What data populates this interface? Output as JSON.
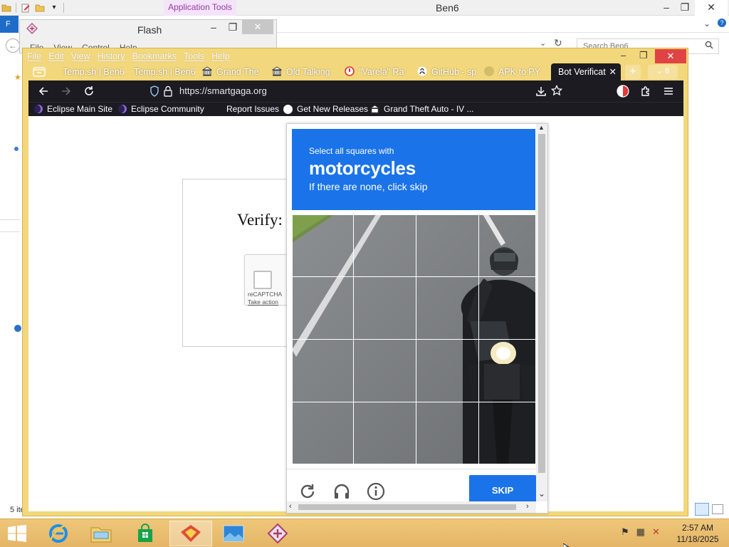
{
  "explorer": {
    "title": "Ben6",
    "app_tools_tab": "Application Tools",
    "file_tab": "F",
    "search_placeholder": "Search Ben6",
    "status_text": "5 ite",
    "controls": {
      "minimize": "–",
      "maximize": "❐",
      "close": "✕"
    }
  },
  "flash": {
    "title": "Flash",
    "menu": [
      "File",
      "View",
      "Control",
      "Help"
    ],
    "controls": {
      "minimize": "–",
      "maximize": "❐",
      "close": "✕"
    }
  },
  "firefox": {
    "menu": [
      "File",
      "Edit",
      "View",
      "History",
      "Bookmarks",
      "Tools",
      "Help"
    ],
    "controls": {
      "minimize": "–",
      "maximize": "❐",
      "close": "✕"
    },
    "tabs": [
      {
        "label": "Temp.sh | Ben6",
        "icon": "bookmark-icon"
      },
      {
        "label": "Temp.sh | Ben6",
        "icon": "bookmark-icon"
      },
      {
        "label": "Grand The",
        "icon": "museum-icon"
      },
      {
        "label": "Old Talking",
        "icon": "museum-icon"
      },
      {
        "label": "\"Varela\" Ra",
        "icon": "record-icon"
      },
      {
        "label": "GitHub - sp",
        "icon": "github-icon"
      },
      {
        "label": "APK to PY",
        "icon": "generic-icon"
      }
    ],
    "active_tab": {
      "label": "Bot Verificat",
      "close": "✕"
    },
    "new_tab": "+",
    "tab_count": "8",
    "url": "https://smartgaga.org",
    "bookmarks": [
      "Eclipse Main Site",
      "Eclipse Community",
      "Report Issues",
      "Get New Releases",
      "Grand Theft Auto - IV ..."
    ]
  },
  "page": {
    "verify_title": "Verify:",
    "recaptcha_label": "reCAPTCHA",
    "recaptcha_action": "Take action"
  },
  "challenge": {
    "instruction_small": "Select all squares with",
    "target": "motorcycles",
    "instruction_sub": "If there are none, click skip",
    "grid_rows": 4,
    "grid_cols": 4,
    "skip_label": "SKIP",
    "footer_icons": [
      "reload-icon",
      "audio-icon",
      "info-icon"
    ]
  },
  "taskbar": {
    "apps": [
      "ie-icon",
      "file-explorer-icon",
      "store-icon",
      "app-red-icon",
      "photos-icon",
      "flash-icon"
    ],
    "active_app": "app-red-icon",
    "time": "2:57 AM",
    "date": "11/18/2025"
  },
  "colors": {
    "firefox_theme": "#f2d77c",
    "firefox_dark": "#1c1b22",
    "recaptcha_blue": "#1a73e8",
    "taskbar": "#e4b567",
    "close_red": "#e04343"
  }
}
